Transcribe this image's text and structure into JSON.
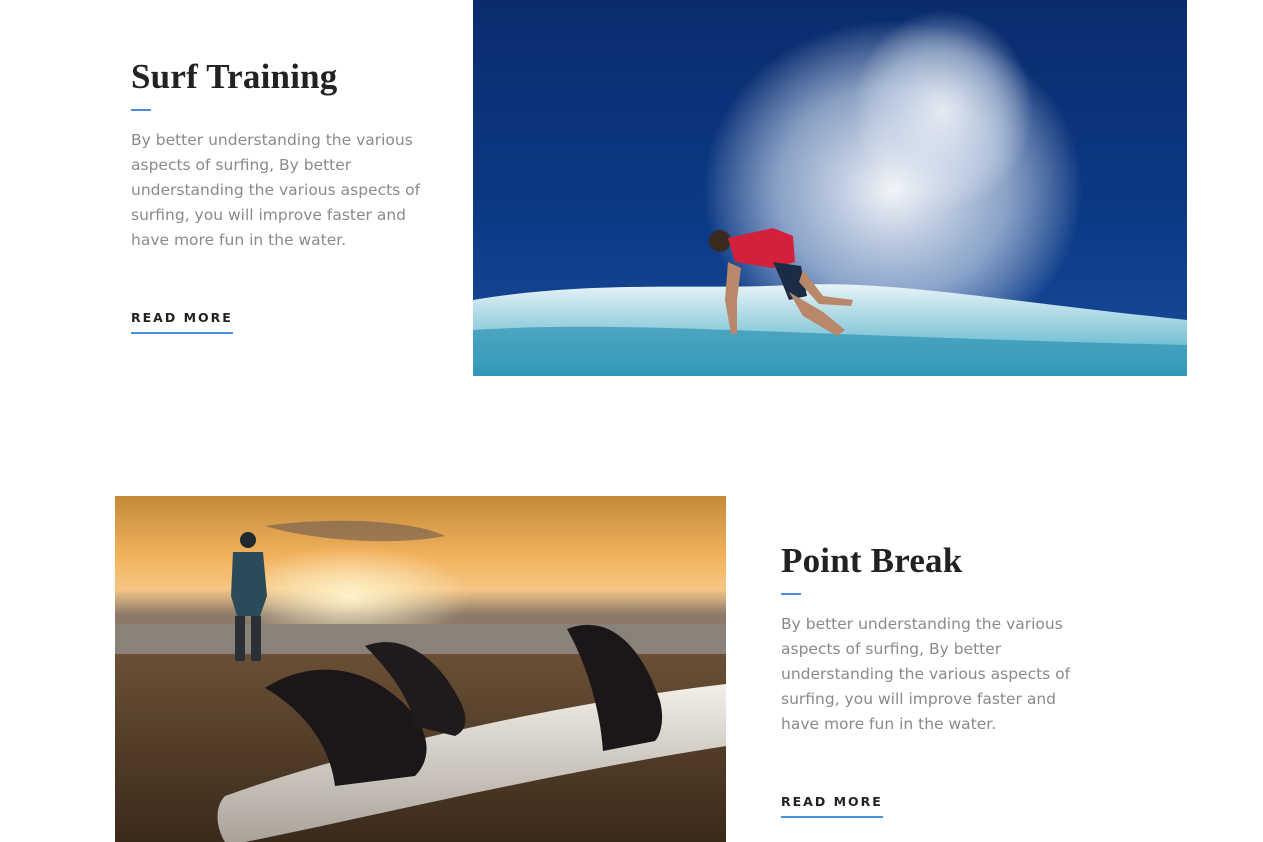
{
  "sections": [
    {
      "title": "Surf Training",
      "description": "By better understanding the various aspects of surfing, By better understanding the various aspects of surfing, you will improve faster and have more fun in the water.",
      "cta_label": "READ MORE",
      "image": "surfer-riding-wave-photo"
    },
    {
      "title": "Point Break",
      "description": "By better understanding the various aspects of surfing, By better understanding the various aspects of surfing, you will improve faster and have more fun in the water.",
      "cta_label": "READ MORE",
      "image": "surfboard-fins-at-sunset-photo"
    }
  ],
  "colors": {
    "accent": "#4a90d9",
    "heading": "#222222",
    "body_text": "#8a8a8a",
    "background": "#ffffff"
  }
}
